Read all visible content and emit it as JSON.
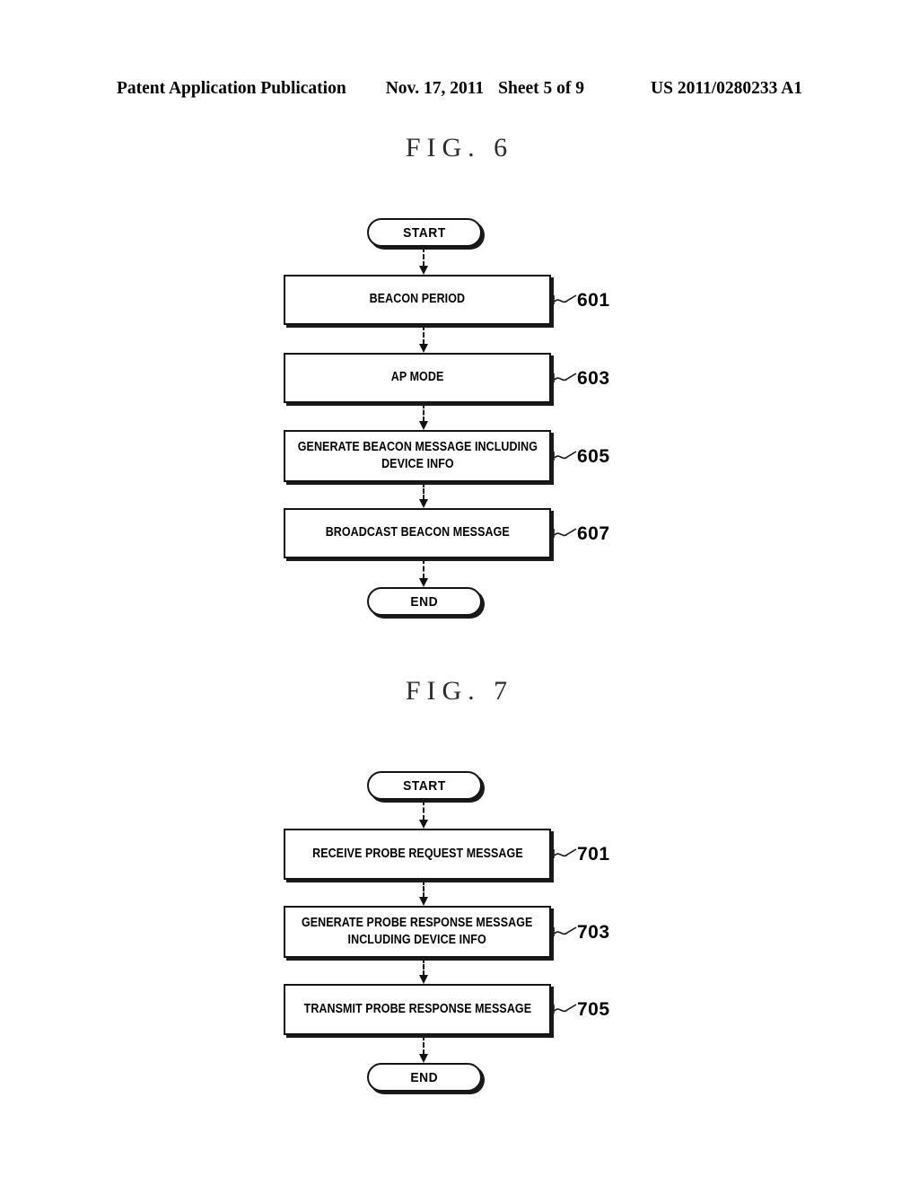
{
  "header": {
    "publication": "Patent Application Publication",
    "date": "Nov. 17, 2011",
    "sheet": "Sheet 5 of 9",
    "patent_number": "US 2011/0280233 A1"
  },
  "figures": [
    {
      "title": "FIG. 6",
      "start_label": "START",
      "end_label": "END",
      "steps": [
        {
          "ref": "601",
          "line1": "BEACON PERIOD",
          "line2": ""
        },
        {
          "ref": "603",
          "line1": "AP MODE",
          "line2": ""
        },
        {
          "ref": "605",
          "line1": "GENERATE BEACON MESSAGE INCLUDING",
          "line2": "DEVICE INFO"
        },
        {
          "ref": "607",
          "line1": "BROADCAST BEACON MESSAGE",
          "line2": ""
        }
      ]
    },
    {
      "title": "FIG. 7",
      "start_label": "START",
      "end_label": "END",
      "steps": [
        {
          "ref": "701",
          "line1": "RECEIVE PROBE REQUEST MESSAGE",
          "line2": ""
        },
        {
          "ref": "703",
          "line1": "GENERATE PROBE RESPONSE MESSAGE",
          "line2": "INCLUDING DEVICE INFO"
        },
        {
          "ref": "705",
          "line1": "TRANSMIT PROBE RESPONSE MESSAGE",
          "line2": ""
        }
      ]
    }
  ],
  "colors": {
    "ink": "#141414",
    "paper": "#ffffff"
  }
}
